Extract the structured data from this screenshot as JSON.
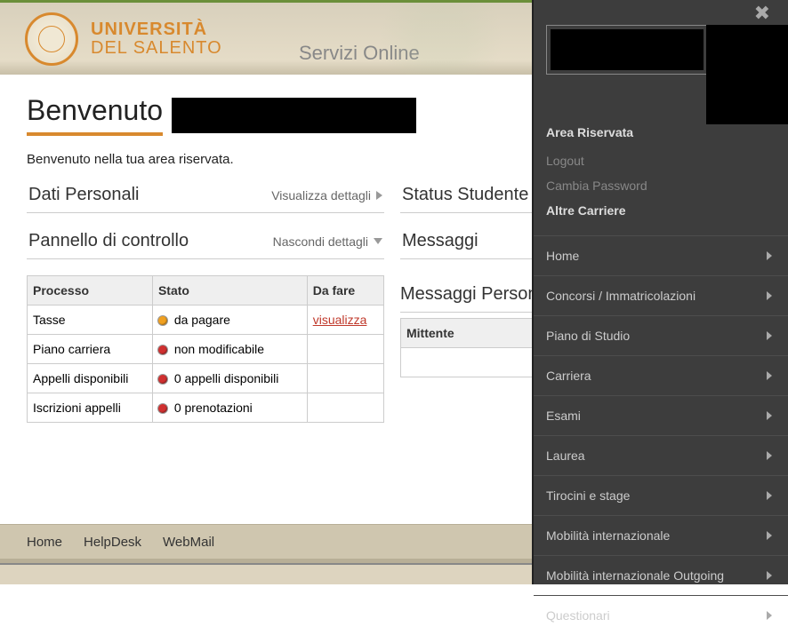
{
  "header": {
    "uni_line1": "UNIVERSITÀ",
    "uni_line2": "DEL SALENTO",
    "servizi": "Servizi Online"
  },
  "page": {
    "welcome": "Benvenuto",
    "subtitle": "Benvenuto nella tua area riservata."
  },
  "left": {
    "dati": {
      "title": "Dati Personali",
      "toggle": "Visualizza dettagli"
    },
    "pannello": {
      "title": "Pannello di controllo",
      "toggle": "Nascondi dettagli"
    },
    "table": {
      "headers": {
        "processo": "Processo",
        "stato": "Stato",
        "dafare": "Da fare"
      },
      "rows": [
        {
          "processo": "Tasse",
          "dot": "orange",
          "stato": "da pagare",
          "dafare": "visualizza",
          "dafare_link": true
        },
        {
          "processo": "Piano carriera",
          "dot": "red",
          "stato": "non modificabile",
          "dafare": ""
        },
        {
          "processo": "Appelli disponibili",
          "dot": "red",
          "stato": "0 appelli disponibili",
          "dafare": ""
        },
        {
          "processo": "Iscrizioni appelli",
          "dot": "red",
          "stato": "0 prenotazioni",
          "dafare": ""
        }
      ]
    }
  },
  "right": {
    "status": {
      "title": "Status Studente"
    },
    "messaggi": {
      "title": "Messaggi"
    },
    "msgp": {
      "title": "Messaggi Personal"
    },
    "msg_table": {
      "mittente": "Mittente"
    }
  },
  "footer": {
    "home": "Home",
    "helpdesk": "HelpDesk",
    "webmail": "WebMail"
  },
  "side": {
    "area": "Area Riservata",
    "logout": "Logout",
    "cambia": "Cambia Password",
    "altre": "Altre Carriere",
    "nav": [
      "Home",
      "Concorsi / Immatricolazioni",
      "Piano di Studio",
      "Carriera",
      "Esami",
      "Laurea",
      "Tirocini e stage",
      "Mobilità internazionale",
      "Mobilità internazionale Outgoing",
      "Questionari"
    ]
  }
}
